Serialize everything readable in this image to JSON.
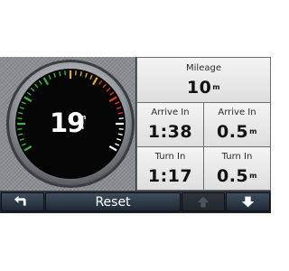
{
  "dial": {
    "speed": "19",
    "unit_top": "m",
    "unit_bottom": "h"
  },
  "cells": {
    "mileage": {
      "label": "Mileage",
      "value": "10",
      "unit": "m"
    },
    "arrive_time": {
      "label": "Arrive In",
      "value": "1:38"
    },
    "arrive_distance": {
      "label": "Arrive In",
      "value": "0.5",
      "unit": "m"
    },
    "turn_time": {
      "label": "Turn In",
      "value": "1:17"
    },
    "turn_distance": {
      "label": "Turn In",
      "value": "0.5",
      "unit": "m"
    }
  },
  "toolbar": {
    "back_icon": "back-arrow-icon",
    "reset_label": "Reset",
    "up_icon": "arrow-up-icon",
    "down_icon": "arrow-down-icon"
  },
  "colors": {
    "gauge_green": "#3fb53a",
    "gauge_amber": "#e0b020",
    "gauge_red": "#e03a22",
    "button_blue": "#2b3a4a"
  }
}
